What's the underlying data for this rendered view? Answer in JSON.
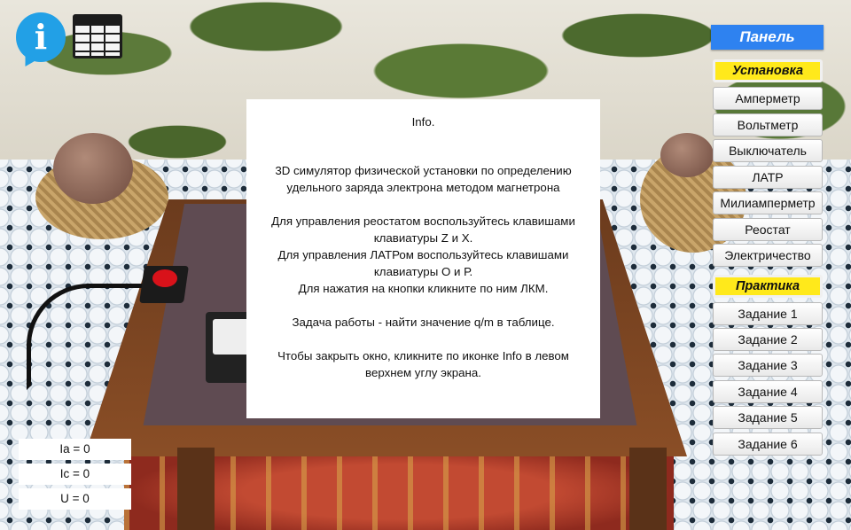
{
  "toolbar": {
    "info_icon": "info-icon",
    "info_glyph": "i",
    "table_icon": "table-grid-icon"
  },
  "info_panel": {
    "title": "Info.",
    "body": "3D симулятор физической установки по определению удельного заряда электрона методом магнетрона\n\nДля управления реостатом воспользуйтесь клавишами клавиатуры Z и X.\nДля управления ЛАТРом воспользуйтесь клавишами клавиатуры О и Р.\nДля нажатия на кнопки кликните по ним ЛКМ.\n\nЗадача работы - найти значение q/m в таблице.\n\nЧтобы закрыть окно, кликните по иконке Info в левом верхнем углу экрана."
  },
  "side_panel": {
    "header": "Панель",
    "setup_label": "Установка",
    "setup_items": [
      "Амперметр",
      "Вольтметр",
      "Выключатель",
      "ЛАТР",
      "Милиамперметр",
      "Реостат",
      "Электричество"
    ],
    "practice_label": "Практика",
    "practice_items": [
      "Задание 1",
      "Задание 2",
      "Задание 3",
      "Задание 4",
      "Задание 5",
      "Задание 6"
    ]
  },
  "readouts": [
    "Ia = 0",
    "Ic = 0",
    "U = 0"
  ],
  "colors": {
    "panel_header": "#2e82f0",
    "section_highlight": "#ffe91b",
    "info_icon": "#22a0e6"
  }
}
